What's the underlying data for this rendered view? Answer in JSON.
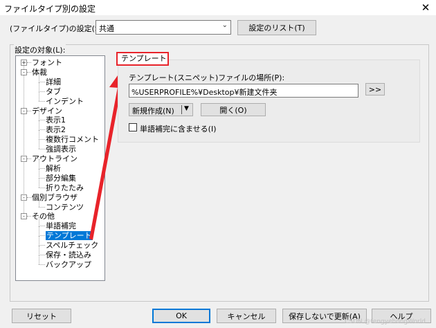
{
  "window": {
    "title": "ファイルタイプ別の設定",
    "close_glyph": "✕"
  },
  "filetype": {
    "label": "(ファイルタイプ)の設定(S):",
    "selected": "共通",
    "list_button": "設定のリスト(T)"
  },
  "target_label": "設定の対象(L):",
  "tree": {
    "items": [
      {
        "label": "フォント",
        "level": 0,
        "expander": "+"
      },
      {
        "label": "体裁",
        "level": 0,
        "expander": "-"
      },
      {
        "label": "詳細",
        "level": 1
      },
      {
        "label": "タブ",
        "level": 1
      },
      {
        "label": "インデント",
        "level": 1
      },
      {
        "label": "デザイン",
        "level": 0,
        "expander": "-"
      },
      {
        "label": "表示1",
        "level": 1
      },
      {
        "label": "表示2",
        "level": 1
      },
      {
        "label": "複数行コメント",
        "level": 1
      },
      {
        "label": "強調表示",
        "level": 1
      },
      {
        "label": "アウトライン",
        "level": 0,
        "expander": "-"
      },
      {
        "label": "解析",
        "level": 1
      },
      {
        "label": "部分編集",
        "level": 1
      },
      {
        "label": "折りたたみ",
        "level": 1
      },
      {
        "label": "個別ブラウザ",
        "level": 0,
        "expander": "-"
      },
      {
        "label": "コンテンツ",
        "level": 1
      },
      {
        "label": "その他",
        "level": 0,
        "expander": "-"
      },
      {
        "label": "単語補完",
        "level": 1
      },
      {
        "label": "テンプレート",
        "level": 1,
        "selected": true
      },
      {
        "label": "スペルチェック",
        "level": 1
      },
      {
        "label": "保存・読込み",
        "level": 1
      },
      {
        "label": "バックアップ",
        "level": 1
      }
    ]
  },
  "panel": {
    "title": "テンプレート",
    "location_label": "テンプレート(スニペット)ファイルの場所(P):",
    "path_value": "%USERPROFILE%¥Desktop¥新建文件夹",
    "browse_button": ">>",
    "new_button": "新規作成(N)",
    "new_arrow": "▼",
    "open_button": "開く(O)",
    "checkbox_label": "単語補完に含ませる(I)"
  },
  "footer": {
    "reset": "リセット",
    "ok": "OK",
    "cancel": "キャンセル",
    "update": "保存しないで更新(A)",
    "help": "ヘルプ"
  },
  "watermark": "CSDN @fengyehongWorld",
  "colors": {
    "annotation_red": "#e8232a",
    "selection_blue": "#0078d7"
  }
}
